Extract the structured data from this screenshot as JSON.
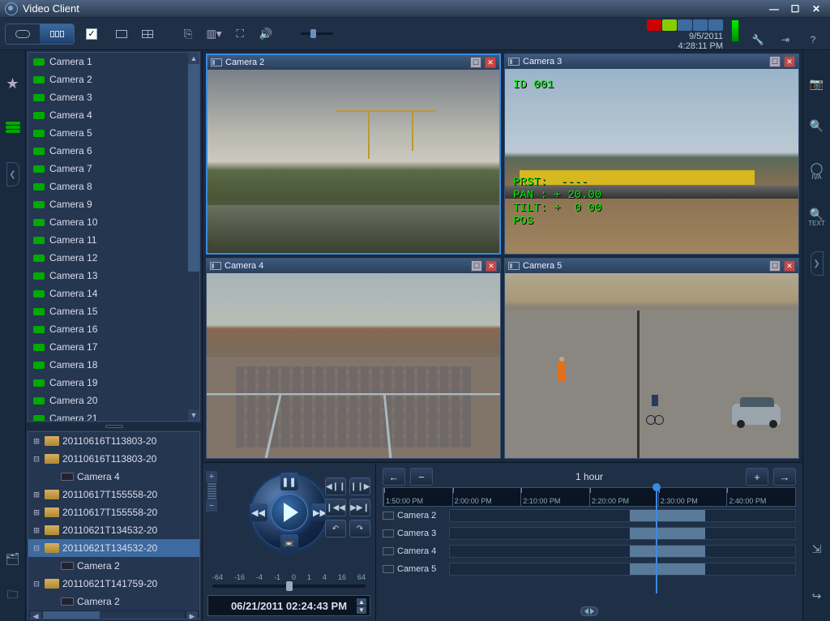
{
  "window": {
    "title": "Video Client"
  },
  "datetime": {
    "date": "9/5/2011",
    "time": "4:28:11 PM"
  },
  "cameras": [
    {
      "name": "Camera 1"
    },
    {
      "name": "Camera 2"
    },
    {
      "name": "Camera 3"
    },
    {
      "name": "Camera 4"
    },
    {
      "name": "Camera 5"
    },
    {
      "name": "Camera 6"
    },
    {
      "name": "Camera 7"
    },
    {
      "name": "Camera 8"
    },
    {
      "name": "Camera 9"
    },
    {
      "name": "Camera 10"
    },
    {
      "name": "Camera 11"
    },
    {
      "name": "Camera 12"
    },
    {
      "name": "Camera 13"
    },
    {
      "name": "Camera 14"
    },
    {
      "name": "Camera 15"
    },
    {
      "name": "Camera 16"
    },
    {
      "name": "Camera 17"
    },
    {
      "name": "Camera 18"
    },
    {
      "name": "Camera 19"
    },
    {
      "name": "Camera 20"
    },
    {
      "name": "Camera 21"
    }
  ],
  "recordings": [
    {
      "type": "folder",
      "expand": "+",
      "name": "20110616T113803-20",
      "indent": 0
    },
    {
      "type": "folder",
      "expand": "−",
      "name": "20110616T113803-20",
      "indent": 0
    },
    {
      "type": "cam",
      "name": "Camera 4",
      "indent": 1
    },
    {
      "type": "folder",
      "expand": "+",
      "name": "20110617T155558-20",
      "indent": 0
    },
    {
      "type": "folder",
      "expand": "+",
      "name": "20110617T155558-20",
      "indent": 0
    },
    {
      "type": "folder",
      "expand": "+",
      "name": "20110621T134532-20",
      "indent": 0
    },
    {
      "type": "folder",
      "expand": "−",
      "name": "20110621T134532-20",
      "indent": 0,
      "selected": true
    },
    {
      "type": "cam",
      "name": "Camera 2",
      "indent": 1
    },
    {
      "type": "folder",
      "expand": "−",
      "name": "20110621T141759-20",
      "indent": 0
    },
    {
      "type": "cam",
      "name": "Camera 2",
      "indent": 1
    }
  ],
  "panes": [
    {
      "title": "Camera 2",
      "active": true,
      "feed": "feed2",
      "overlay": null
    },
    {
      "title": "Camera 3",
      "active": false,
      "feed": "feed3",
      "overlay": {
        "id": "ID 001",
        "stats": "PRST:  ----\nPAN : + 20.00\nTILT: +  0 00\nPOS"
      }
    },
    {
      "title": "Camera 4",
      "active": false,
      "feed": "feed4",
      "overlay": null
    },
    {
      "title": "Camera 5",
      "active": false,
      "feed": "feed5",
      "overlay": null
    }
  ],
  "playback": {
    "speeds": [
      "-64",
      "-16",
      "-4",
      "-1",
      "0",
      "1",
      "4",
      "16",
      "64"
    ],
    "timestamp": "06/21/2011 02:24:43 PM"
  },
  "timeline": {
    "range": "1 hour",
    "ticks": [
      "1:50:00 PM",
      "2:00:00 PM",
      "2:10:00 PM",
      "2:20:00 PM",
      "2:30:00 PM",
      "2:40:00 PM"
    ],
    "playhead_pct": 60,
    "rows": [
      {
        "name": "Camera 2",
        "clips": [
          {
            "l": 52,
            "w": 22
          }
        ]
      },
      {
        "name": "Camera 3",
        "clips": [
          {
            "l": 52,
            "w": 22
          }
        ]
      },
      {
        "name": "Camera 4",
        "clips": [
          {
            "l": 52,
            "w": 22
          }
        ]
      },
      {
        "name": "Camera 5",
        "clips": [
          {
            "l": 52,
            "w": 22
          }
        ]
      }
    ]
  }
}
